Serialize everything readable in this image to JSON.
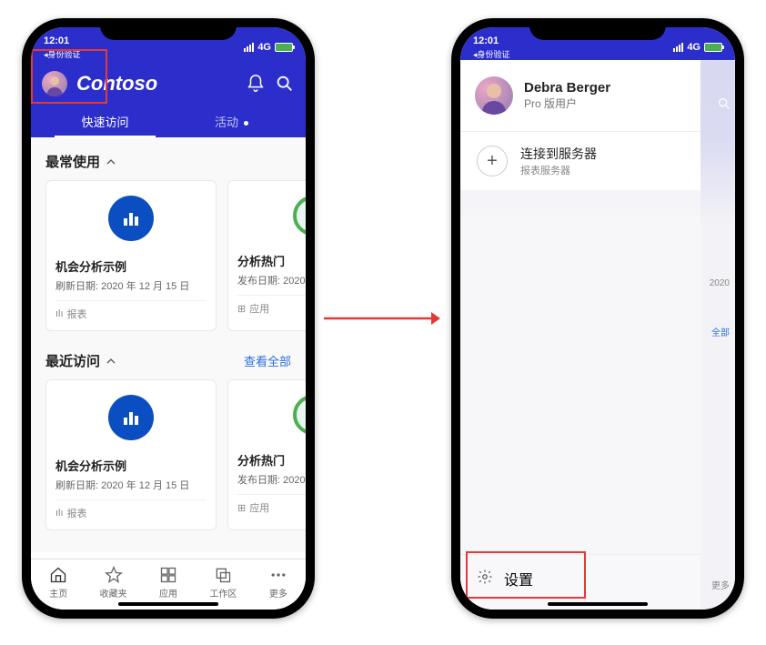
{
  "status": {
    "time": "12:01",
    "breadcrumb": "◂身份验证",
    "network": "4G"
  },
  "phone1": {
    "brand": "Contoso",
    "tabs": {
      "quick": "快速访问",
      "activity": "活动"
    },
    "section_frequent": "最常使用",
    "section_recent": "最近访问",
    "view_all": "查看全部",
    "cards": {
      "c1": {
        "title": "机会分析示例",
        "sub": "刷新日期: 2020 年 12 月 15 日",
        "type": "报表",
        "type_glyph": "ılı"
      },
      "c2": {
        "title": "分析热门",
        "sub": "发布日期: 2020",
        "type": "应用",
        "type_glyph": "⊞"
      },
      "c3": {
        "title": "机会分析示例",
        "sub": "刷新日期: 2020 年 12 月 15 日",
        "type": "报表",
        "type_glyph": "ılı"
      },
      "c4": {
        "title": "分析热门",
        "sub": "发布日期: 2020",
        "type": "应用",
        "type_glyph": "⊞"
      }
    },
    "nav": {
      "home": "主页",
      "fav": "收藏夹",
      "apps": "应用",
      "workspaces": "工作区",
      "more": "更多"
    }
  },
  "phone2": {
    "user": {
      "name": "Debra Berger",
      "sub": "Pro 版用户"
    },
    "connect": {
      "title": "连接到服务器",
      "sub": "报表服务器"
    },
    "settings": "设置",
    "peek": {
      "y2020": "2020",
      "viewall": "全部",
      "more": "更多"
    }
  }
}
